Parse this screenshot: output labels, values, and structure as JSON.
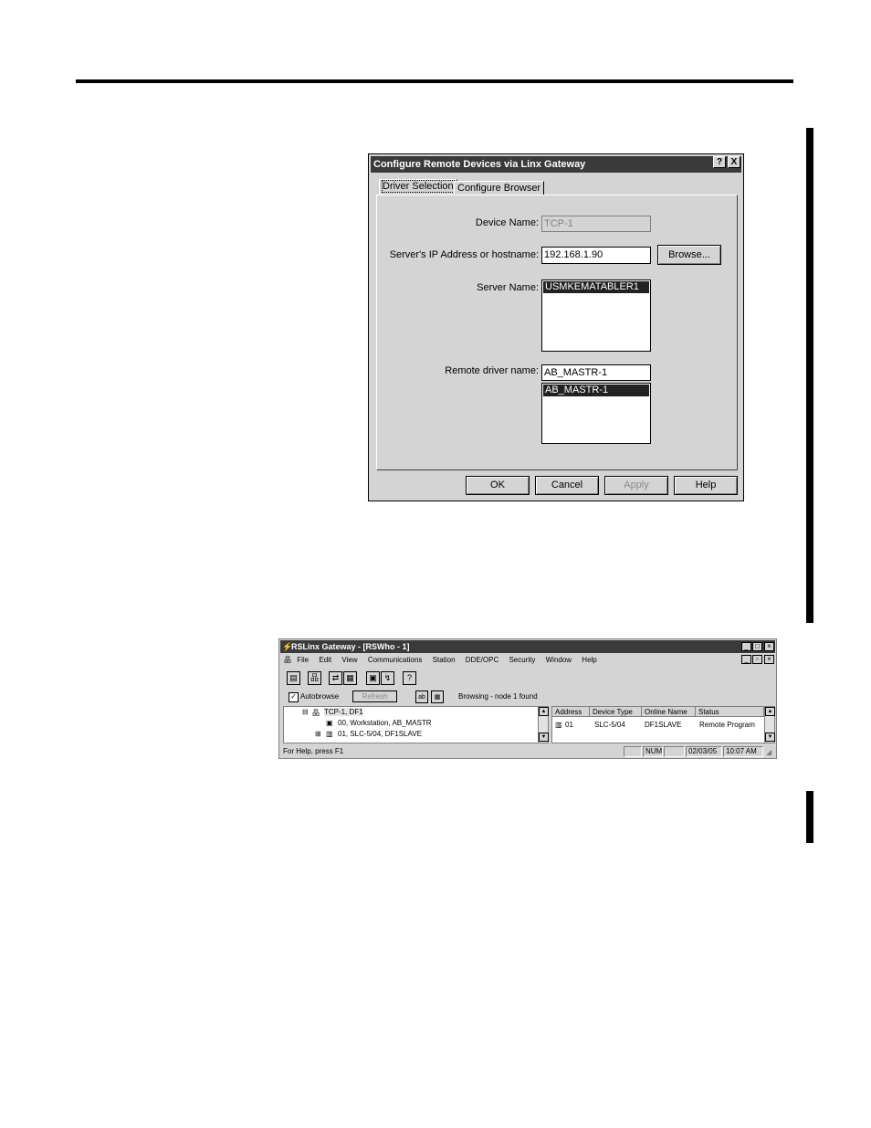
{
  "dialog": {
    "title": "Configure Remote Devices via Linx Gateway",
    "help_btn": "?",
    "close_btn": "X",
    "tabs": [
      {
        "label": "Driver Selection",
        "active": true
      },
      {
        "label": "Configure Browser",
        "active": false
      }
    ],
    "device_name_label": "Device Name:",
    "device_name_value": "TCP-1",
    "server_ip_label": "Server's IP Address or hostname:",
    "server_ip_value": "192.168.1.90",
    "browse_btn": "Browse...",
    "server_name_label": "Server Name:",
    "server_name_items": [
      "USMKEMATABLER1"
    ],
    "remote_driver_label": "Remote driver name:",
    "remote_driver_value": "AB_MASTR-1",
    "remote_driver_items": [
      "AB_MASTR-1"
    ],
    "buttons": {
      "ok": "OK",
      "cancel": "Cancel",
      "apply": "Apply",
      "help": "Help"
    }
  },
  "rslinx": {
    "title": "RSLinx Gateway - [RSWho - 1]",
    "menu": [
      "File",
      "Edit",
      "View",
      "Communications",
      "Station",
      "DDE/OPC",
      "Security",
      "Window",
      "Help"
    ],
    "autobrowse_label": "Autobrowse",
    "autobrowse_checked": true,
    "refresh_label": "Refresh",
    "browsing_status": "Browsing - node 1 found",
    "tree": [
      {
        "label": "TCP-1, DF1",
        "expander": "⊟"
      },
      {
        "label": "00, Workstation, AB_MASTR",
        "expander": ""
      },
      {
        "label": "01, SLC-5/04, DF1SLAVE",
        "expander": "⊞"
      }
    ],
    "columns": [
      "Address",
      "Device Type",
      "Online Name",
      "Status"
    ],
    "rows": [
      {
        "address": "01",
        "device_type": "SLC-5/04",
        "online_name": "DF1SLAVE",
        "status": "Remote Program"
      }
    ],
    "statusbar": {
      "help": "For Help, press F1",
      "num": "NUM",
      "date": "02/03/05",
      "time": "10:07 AM"
    }
  }
}
